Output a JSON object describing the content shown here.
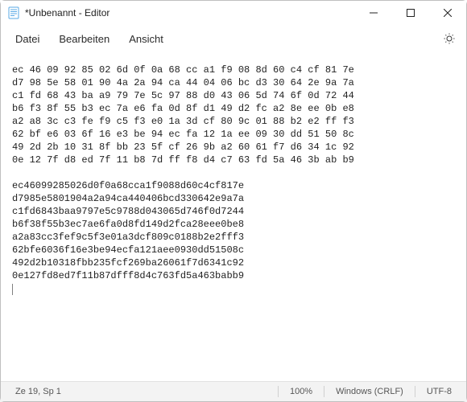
{
  "window": {
    "title": "*Unbenannt - Editor"
  },
  "menu": {
    "file": "Datei",
    "edit": "Bearbeiten",
    "view": "Ansicht"
  },
  "icons": {
    "notepad": "notepad-icon",
    "minimize": "minimize-icon",
    "maximize": "maximize-icon",
    "close": "close-icon",
    "settings": "gear-icon"
  },
  "editor": {
    "lines": [
      "ec 46 09 92 85 02 6d 0f 0a 68 cc a1 f9 08 8d 60 c4 cf 81 7e",
      "d7 98 5e 58 01 90 4a 2a 94 ca 44 04 06 bc d3 30 64 2e 9a 7a",
      "c1 fd 68 43 ba a9 79 7e 5c 97 88 d0 43 06 5d 74 6f 0d 72 44",
      "b6 f3 8f 55 b3 ec 7a e6 fa 0d 8f d1 49 d2 fc a2 8e ee 0b e8",
      "a2 a8 3c c3 fe f9 c5 f3 e0 1a 3d cf 80 9c 01 88 b2 e2 ff f3",
      "62 bf e6 03 6f 16 e3 be 94 ec fa 12 1a ee 09 30 dd 51 50 8c",
      "49 2d 2b 10 31 8f bb 23 5f cf 26 9b a2 60 61 f7 d6 34 1c 92",
      "0e 12 7f d8 ed 7f 11 b8 7d ff f8 d4 c7 63 fd 5a 46 3b ab b9",
      "",
      "ec46099285026d0f0a68cca1f9088d60c4cf817e",
      "d7985e5801904a2a94ca440406bcd330642e9a7a",
      "c1fd6843baa9797e5c9788d043065d746f0d7244",
      "b6f38f55b3ec7ae6fa0d8fd149d2fca28eee0be8",
      "a2a83cc3fef9c5f3e01a3dcf809c0188b2e2fff3",
      "62bfe6036f16e3be94ecfa121aee0930dd51508c",
      "492d2b10318fbb235fcf269ba26061f7d6341c92",
      "0e127fd8ed7f11b87dfff8d4c763fd5a463babb9"
    ]
  },
  "status": {
    "position": "Ze 19, Sp 1",
    "zoom": "100%",
    "line_ending": "Windows (CRLF)",
    "encoding": "UTF-8"
  }
}
